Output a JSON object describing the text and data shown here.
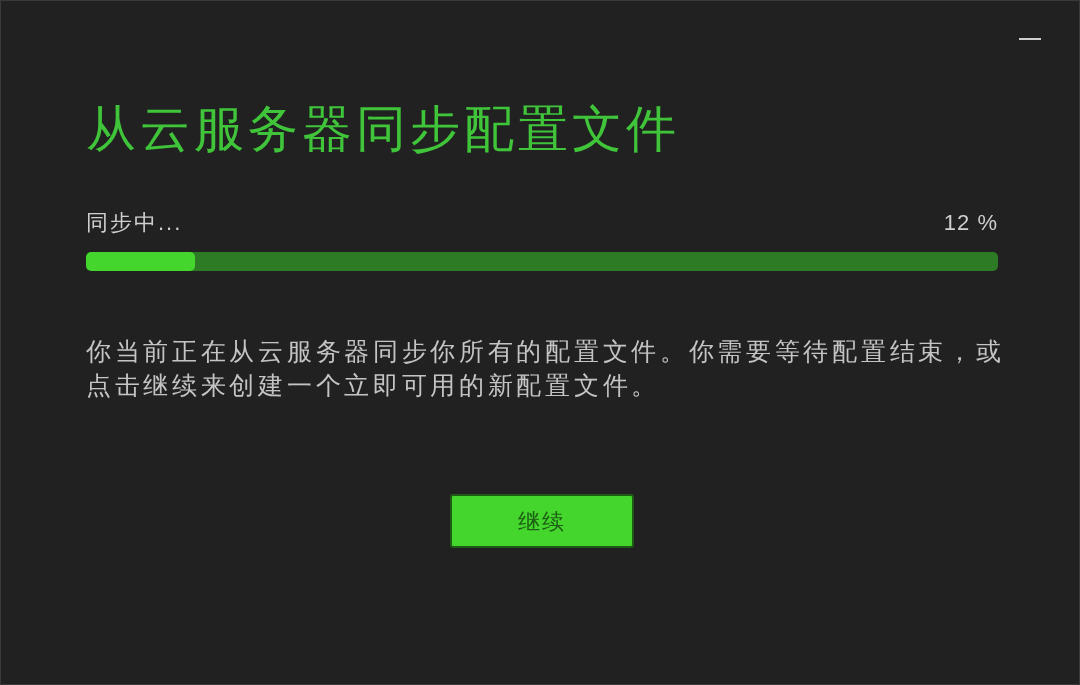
{
  "title": "从云服务器同步配置文件",
  "progress": {
    "label": "同步中...",
    "reading": "12 %",
    "level": 0.12
  },
  "description": "你当前正在从云服务器同步你所有的配置文件。你需要等待配置结束，或点击继续来创建一个立即可用的新配置文件。",
  "button": {
    "label": "继续"
  }
}
